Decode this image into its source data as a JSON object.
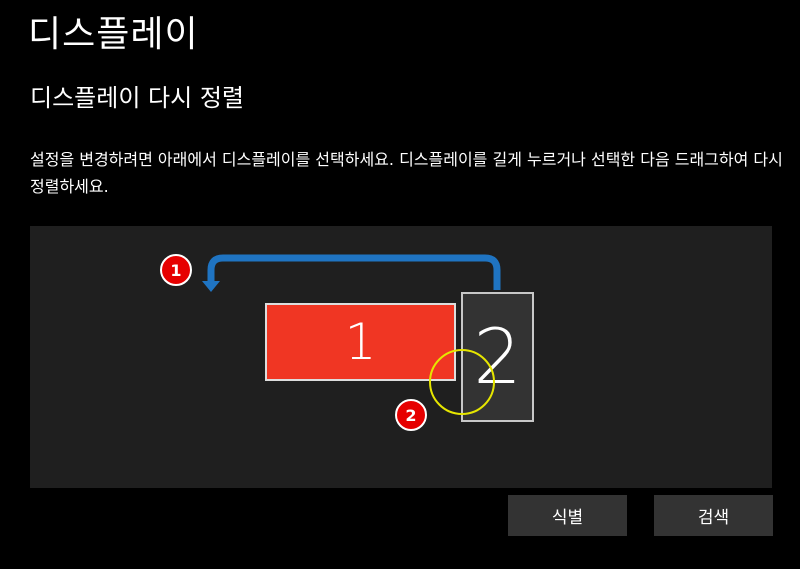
{
  "page": {
    "title": "디스플레이",
    "section_title": "디스플레이 다시 정렬",
    "description": "설정을 변경하려면 아래에서 디스플레이를 선택하세요. 디스플레이를 길게 누르거나 선택한 다음 드래그하여 다시 정렬하세요."
  },
  "arrangement": {
    "monitors": [
      {
        "number": "1",
        "color": "#f03623",
        "state": "selected"
      },
      {
        "number": "2",
        "color": "#333333",
        "state": "unselected"
      }
    ],
    "annotations": {
      "step1_label": "1",
      "step2_label": "2",
      "arrow_color": "#1f74c2",
      "badge_color": "#e60000",
      "highlight_circle_color": "#e6e600"
    }
  },
  "buttons": {
    "identify_label": "식별",
    "detect_label": "검색"
  }
}
